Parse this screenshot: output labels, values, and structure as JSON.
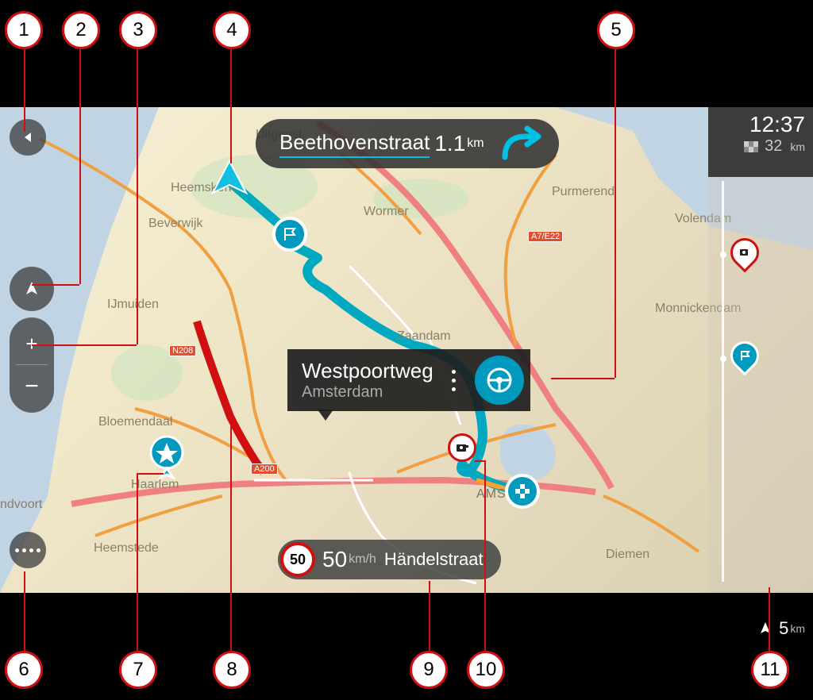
{
  "instruction": {
    "street": "Beethovenstraat",
    "distance": "1.1",
    "unit": "km"
  },
  "selected": {
    "name": "Westpoortweg",
    "city": "Amsterdam"
  },
  "speed": {
    "limit": "50",
    "current": "50",
    "unit": "km/h",
    "street": "Händelstraat"
  },
  "routebar": {
    "time": "12:37",
    "remaining_value": "32",
    "remaining_unit": "km",
    "scale_value": "5",
    "scale_unit": "km"
  },
  "cities": {
    "uitgeest": "Uitgeest",
    "heemskerk": "Heemskerk",
    "beverwijk": "Beverwijk",
    "ijmuiden": "IJmuiden",
    "bloemendaal": "Bloemendaal",
    "haarlem": "Haarlem",
    "ndvoort": "ndvoort",
    "heemstede": "Heemstede",
    "wormer": "Wormer",
    "purmerend": "Purmerend",
    "zaandam": "Zaandam",
    "amsterdam": "AMS          AM",
    "diemen": "Diemen",
    "volendam": "Volendam",
    "monnickendam": "Monnickendam"
  },
  "roadnums": {
    "n208": "N208",
    "a200": "A200",
    "a7e22": "A7/E22"
  },
  "icons": {
    "back": "back-icon",
    "compass": "compass-icon",
    "plus": "+",
    "minus": "−",
    "menu": "menu-icon",
    "flag": "flag-icon",
    "dest": "dest-icon",
    "star": "star-icon",
    "camera": "camera-icon",
    "wheel": "wheel-icon",
    "cursor": "cursor-icon"
  },
  "callouts": [
    "1",
    "2",
    "3",
    "4",
    "5",
    "6",
    "7",
    "8",
    "9",
    "10",
    "11"
  ]
}
